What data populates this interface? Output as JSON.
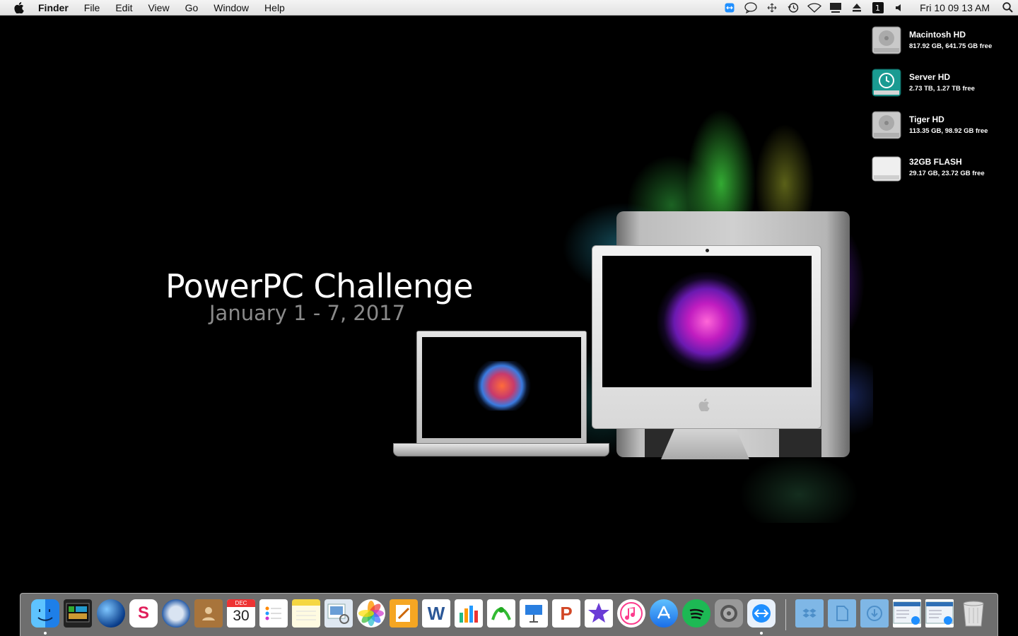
{
  "menubar": {
    "app_name": "Finder",
    "menus": [
      "File",
      "Edit",
      "View",
      "Go",
      "Window",
      "Help"
    ],
    "status_icons": [
      "teamviewer-icon",
      "messages-icon",
      "move-icon",
      "time-machine-icon",
      "wifi-icon",
      "display-icon",
      "eject-icon",
      "input-source-icon",
      "volume-icon"
    ],
    "clock": "Fri 10 09 13 AM"
  },
  "wallpaper": {
    "title": "PowerPC Challenge",
    "subtitle": "January 1 - 7, 2017"
  },
  "volumes": [
    {
      "name": "Macintosh HD",
      "info": "817.92 GB, 641.75 GB free",
      "icon": "hard-drive-icon"
    },
    {
      "name": "Server HD",
      "info": "2.73 TB, 1.27 TB free",
      "icon": "time-machine-drive-icon"
    },
    {
      "name": "Tiger HD",
      "info": "113.35 GB, 98.92 GB free",
      "icon": "hard-drive-icon"
    },
    {
      "name": "32GB FLASH",
      "info": "29.17 GB, 23.72 GB free",
      "icon": "external-drive-icon"
    }
  ],
  "dock": {
    "calendar_month": "DEC",
    "calendar_day": "30",
    "apps": [
      "finder-icon",
      "activity-monitor-icon",
      "network-globe-icon",
      "slack-icon",
      "thunderbird-icon",
      "contacts-icon",
      "calendar-icon",
      "reminders-icon",
      "notes-icon",
      "preview-icon",
      "photos-icon",
      "pages-icon",
      "word-icon",
      "numbers-icon",
      "sketch-icon",
      "keynote-icon",
      "powerpoint-icon",
      "imovie-icon",
      "itunes-icon",
      "app-store-icon",
      "spotify-icon",
      "system-preferences-icon",
      "teamviewer-icon"
    ],
    "stacks": [
      "dropbox-folder-icon",
      "documents-folder-icon",
      "downloads-folder-icon",
      "teamviewer-window-icon",
      "teamviewer-window-icon-2",
      "trash-icon"
    ],
    "colors": {
      "finder": "#1e90ff",
      "slack": "#e01e5a",
      "spotify": "#1db954",
      "itunes": "#fc3c8d",
      "appstore": "#1a8cff"
    }
  }
}
